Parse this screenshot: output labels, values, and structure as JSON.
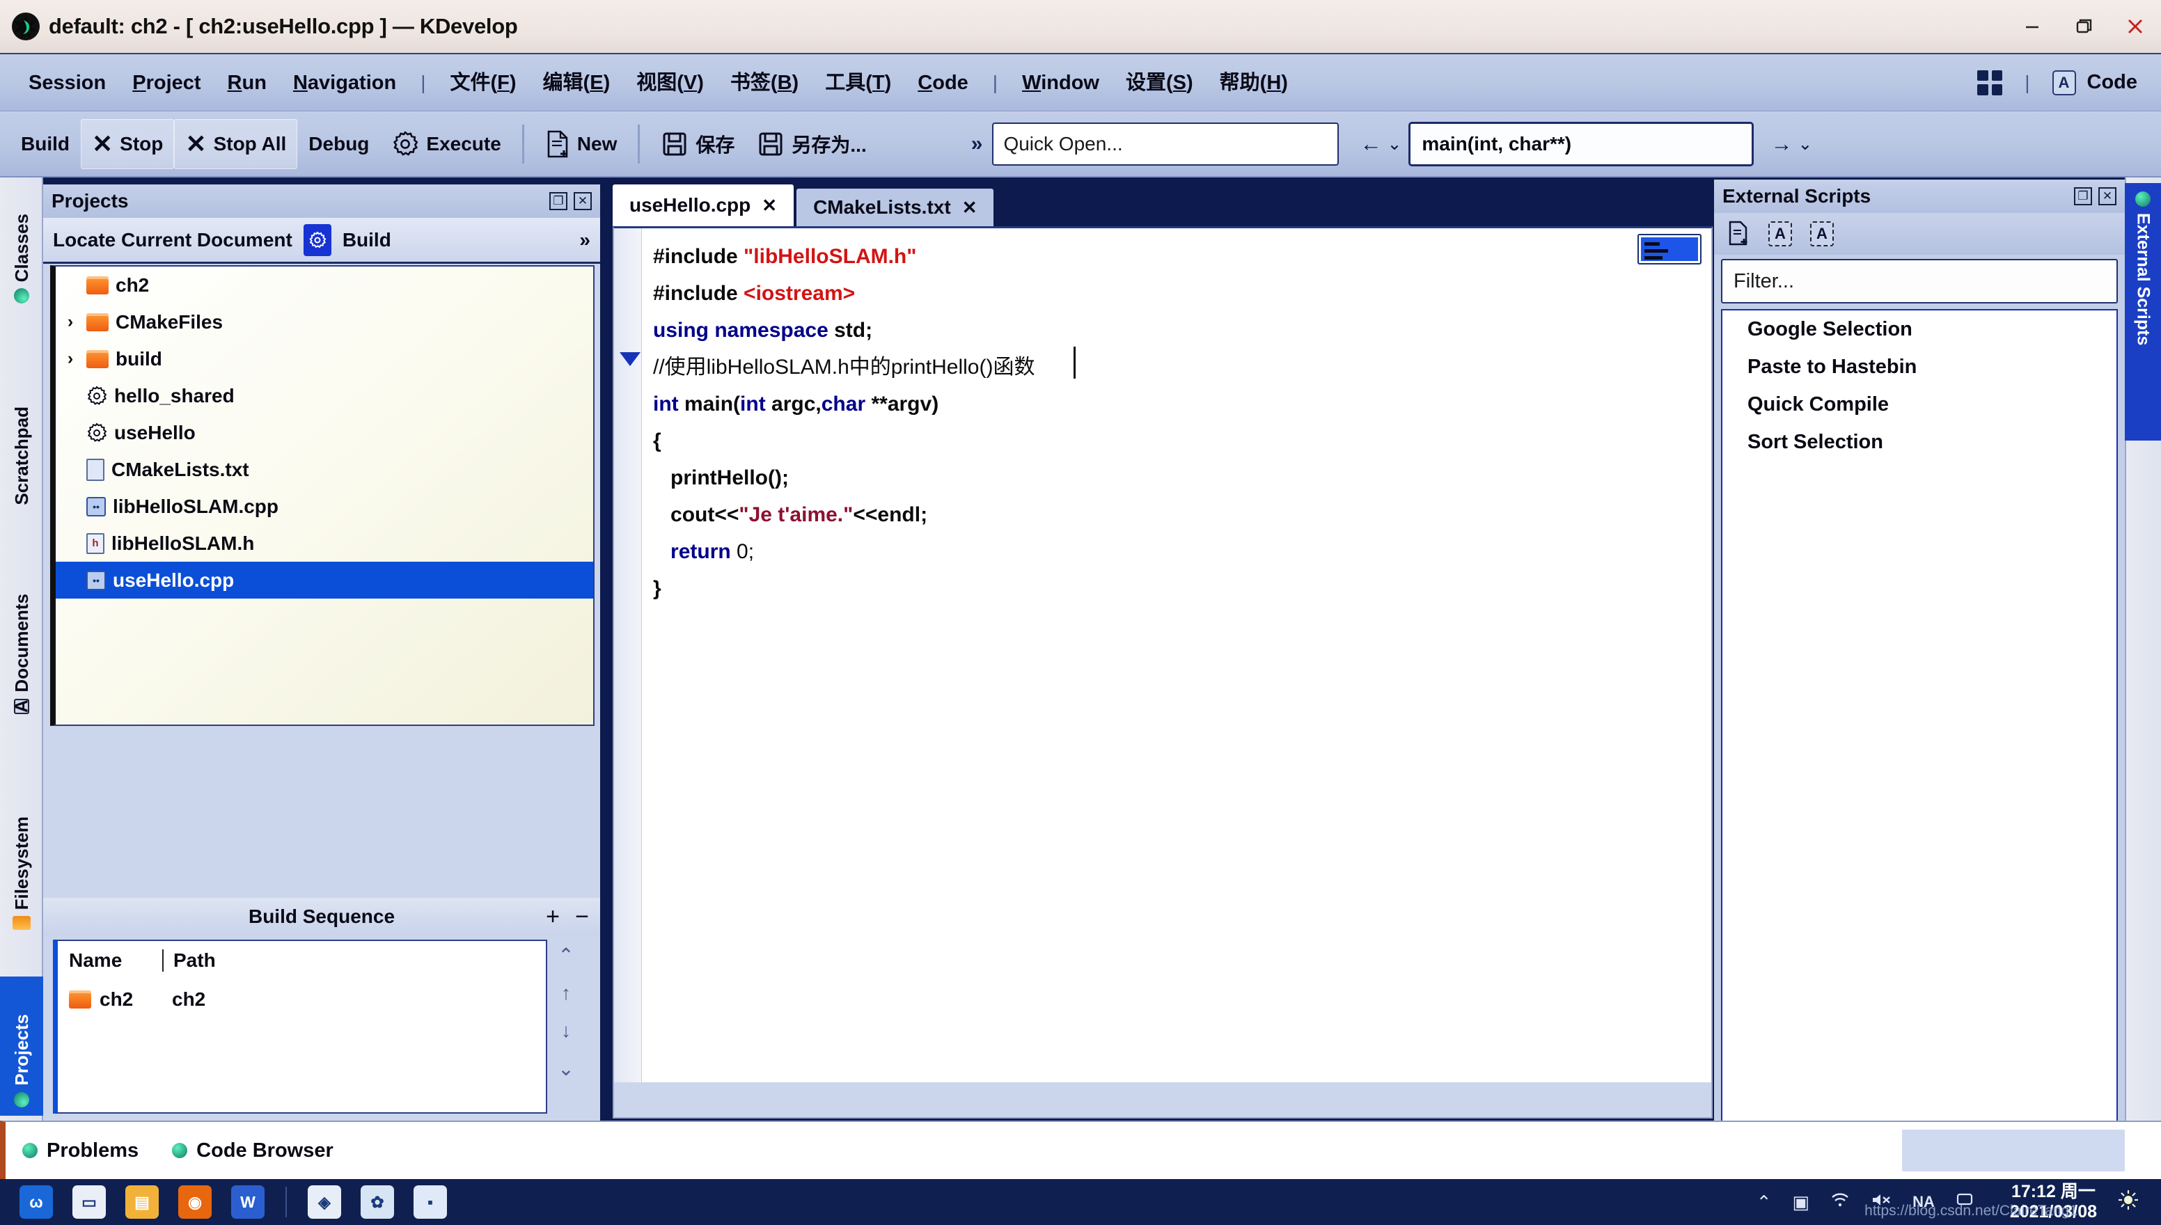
{
  "window": {
    "title": "default: ch2 - [ ch2:useHello.cpp ] — KDevelop",
    "app_icon": "kdevelop-icon",
    "minimize": "—",
    "restore": "❐",
    "close": "✕"
  },
  "menubar": {
    "items": [
      {
        "label": "Session",
        "accel": "",
        "name": "menu-session"
      },
      {
        "label": "Project",
        "accel": "P",
        "name": "menu-project"
      },
      {
        "label": "Run",
        "accel": "R",
        "name": "menu-run"
      },
      {
        "label": "Navigation",
        "accel": "N",
        "name": "menu-navigation"
      },
      {
        "label": "|",
        "sep": true,
        "name": "menu-separator-1"
      },
      {
        "label": "文件(F)",
        "accel": "F",
        "name": "menu-file-cn"
      },
      {
        "label": "编辑(E)",
        "accel": "E",
        "name": "menu-edit-cn"
      },
      {
        "label": "视图(V)",
        "accel": "V",
        "name": "menu-view-cn"
      },
      {
        "label": "书签(B)",
        "accel": "B",
        "name": "menu-bookmarks-cn"
      },
      {
        "label": "工具(T)",
        "accel": "T",
        "name": "menu-tools-cn"
      },
      {
        "label": "Code",
        "accel": "C",
        "name": "menu-code"
      },
      {
        "label": "|",
        "sep": true,
        "name": "menu-separator-2"
      },
      {
        "label": "Window",
        "accel": "W",
        "name": "menu-window"
      },
      {
        "label": "设置(S)",
        "accel": "S",
        "name": "menu-settings-cn"
      },
      {
        "label": "帮助(H)",
        "accel": "H",
        "name": "menu-help-cn"
      }
    ],
    "right": {
      "grid_icon": "grid-icon",
      "separator": "|",
      "code_badge": "A",
      "code_label": "Code"
    }
  },
  "toolbar": {
    "build": "Build",
    "stop": "Stop",
    "stop_all": "Stop All",
    "debug": "Debug",
    "execute": "Execute",
    "new": "New",
    "save": "保存",
    "save_as": "另存为...",
    "overflow": "»",
    "quick_open_placeholder": "Quick Open...",
    "back_arrow": "←",
    "back_caret": "⌄",
    "function_signature": "main(int, char**)",
    "forward_arrow": "→",
    "forward_caret": "⌄"
  },
  "left_rail": {
    "tabs": [
      {
        "label": "Classes",
        "icon": "classes-dot-icon",
        "active": false
      },
      {
        "label": "Scratchpad",
        "icon": "scratchpad-icon",
        "active": false
      },
      {
        "label": "Documents",
        "icon": "documents-icon",
        "active": false
      },
      {
        "label": "Filesystem",
        "icon": "folder-icon",
        "active": false
      },
      {
        "label": "Projects",
        "icon": "projects-dot-icon",
        "active": true
      }
    ]
  },
  "right_rail": {
    "tabs": [
      {
        "label": "External Scripts",
        "icon": "scripts-dot-icon",
        "active": true
      }
    ]
  },
  "projects_panel": {
    "title": "Projects",
    "float_btn": "❐",
    "close_btn": "✕",
    "locate_current_document": "Locate Current Document",
    "build_label": "Build",
    "overflow": "»",
    "tree": [
      {
        "label": "ch2",
        "icon": "folder-icon",
        "twisty": "",
        "indent": 0,
        "selected": false
      },
      {
        "label": "CMakeFiles",
        "icon": "folder-icon",
        "twisty": "›",
        "indent": 0,
        "selected": false
      },
      {
        "label": "build",
        "icon": "folder-icon",
        "twisty": "›",
        "indent": 0,
        "selected": false
      },
      {
        "label": "hello_shared",
        "icon": "target-icon",
        "twisty": "",
        "indent": 0,
        "selected": false
      },
      {
        "label": "useHello",
        "icon": "target-icon",
        "twisty": "",
        "indent": 0,
        "selected": false
      },
      {
        "label": "CMakeLists.txt",
        "icon": "text-file-icon",
        "twisty": "",
        "indent": 0,
        "selected": false
      },
      {
        "label": "libHelloSLAM.cpp",
        "icon": "cpp-file-icon",
        "twisty": "",
        "indent": 0,
        "selected": false
      },
      {
        "label": "libHelloSLAM.h",
        "icon": "header-file-icon",
        "twisty": "",
        "indent": 0,
        "selected": false
      },
      {
        "label": "useHello.cpp",
        "icon": "cpp-file-icon",
        "twisty": "",
        "indent": 0,
        "selected": true
      }
    ]
  },
  "build_sequence": {
    "title": "Build Sequence",
    "add_btn": "+",
    "remove_btn": "−",
    "columns": [
      "Name",
      "Path"
    ],
    "rows": [
      {
        "name": "ch2",
        "path": "ch2",
        "icon": "folder-icon"
      }
    ],
    "arrows": [
      "⌃",
      "↑",
      "↓",
      "⌄"
    ]
  },
  "editor": {
    "tabs": [
      {
        "label": "useHello.cpp",
        "close": "✕",
        "active": true
      },
      {
        "label": "CMakeLists.txt",
        "close": "✕",
        "active": false
      }
    ],
    "code_lines": [
      [
        {
          "t": "#include ",
          "c": "pp"
        },
        {
          "t": "\"libHelloSLAM.h\"",
          "c": "str"
        }
      ],
      [
        {
          "t": "#include ",
          "c": "pp"
        },
        {
          "t": "<iostream>",
          "c": "str"
        }
      ],
      [
        {
          "t": "using namespace ",
          "c": "kw"
        },
        {
          "t": "std;",
          "c": "pl"
        }
      ],
      [
        {
          "t": "//使用libHelloSLAM.h中的printHello()函数",
          "c": "cmt"
        }
      ],
      [
        {
          "t": "int ",
          "c": "kw"
        },
        {
          "t": "main",
          "c": "fn"
        },
        {
          "t": "(",
          "c": "pl"
        },
        {
          "t": "int ",
          "c": "kw"
        },
        {
          "t": "argc,",
          "c": "pl"
        },
        {
          "t": "char ",
          "c": "kw"
        },
        {
          "t": "**argv",
          "c": "fn"
        },
        {
          "t": ")",
          "c": "pl"
        }
      ],
      [
        {
          "t": "{",
          "c": "pl"
        }
      ],
      [
        {
          "t": "   printHello();",
          "c": "pl"
        }
      ],
      [
        {
          "t": "   cout<<",
          "c": "pl"
        },
        {
          "t": "\"Je t'aime.\"",
          "c": "strq"
        },
        {
          "t": "<<endl;",
          "c": "pl"
        }
      ],
      [
        {
          "t": "   ",
          "c": "pl"
        },
        {
          "t": "return ",
          "c": "kw"
        },
        {
          "t": "0;",
          "c": "num"
        }
      ],
      [
        {
          "t": "}",
          "c": "pl"
        }
      ]
    ],
    "fold_marker": "▼"
  },
  "external_scripts": {
    "title": "External Scripts",
    "float_btn": "❐",
    "close_btn": "✕",
    "toolbar_icons": [
      "new-script-icon",
      "edit-font-icon",
      "edit-font-alt-icon"
    ],
    "filter_placeholder": "Filter...",
    "items": [
      {
        "label": "Google Selection"
      },
      {
        "label": "Paste to Hastebin"
      },
      {
        "label": "Quick Compile"
      },
      {
        "label": "Sort Selection"
      }
    ]
  },
  "statusbar": {
    "items": [
      {
        "label": "Problems",
        "icon": "problems-dot-icon"
      },
      {
        "label": "Code Browser",
        "icon": "code-browser-dot-icon"
      }
    ]
  },
  "taskbar": {
    "icons": [
      {
        "name": "wps-icon",
        "glyph": "ω",
        "bg": "#1a68d8"
      },
      {
        "name": "window-switch-icon",
        "glyph": "▭",
        "bg": "#e9eef7"
      },
      {
        "name": "file-explorer-icon",
        "glyph": "▤",
        "bg": "#f2b23a"
      },
      {
        "name": "firefox-icon",
        "glyph": "◉",
        "bg": "#e8660e"
      },
      {
        "name": "wechat-work-icon",
        "glyph": "W",
        "bg": "#2b5fd0"
      },
      {
        "name": "divider",
        "glyph": "",
        "bg": ""
      },
      {
        "name": "security-shield-icon",
        "glyph": "◈",
        "bg": "#e8eef8"
      },
      {
        "name": "vmware-icon",
        "glyph": "✿",
        "bg": "#d7e4f4"
      },
      {
        "name": "terminal-icon",
        "glyph": "▪",
        "bg": "#dfe9f7"
      }
    ],
    "tray": [
      {
        "name": "chevron-up-icon",
        "glyph": "⌃"
      },
      {
        "name": "display-icon",
        "glyph": "▣"
      },
      {
        "name": "wifi-icon",
        "glyph": "◢"
      },
      {
        "name": "volume-muted-icon",
        "glyph": "🔇"
      },
      {
        "name": "ime-icon",
        "glyph": "NA"
      },
      {
        "name": "notifications-icon",
        "glyph": "▭"
      }
    ],
    "clock_time": "17:12 周一",
    "clock_date": "2021/03/08",
    "brightness_icon": "brightness-icon"
  },
  "watermark": "https://blog.csdn.net/ClaireTang1"
}
